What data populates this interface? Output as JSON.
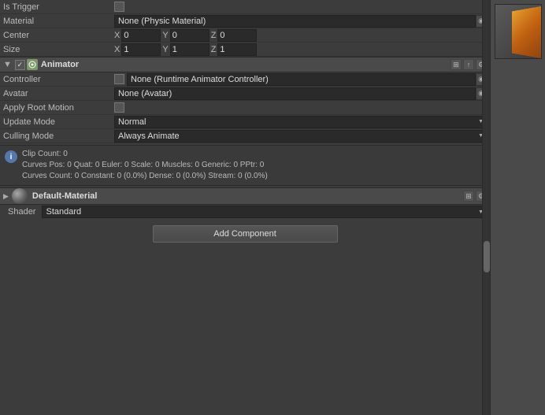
{
  "inspector": {
    "rows": {
      "is_trigger": {
        "label": "Is Trigger",
        "value": ""
      },
      "material": {
        "label": "Material",
        "value": "None (Physic Material)"
      },
      "center": {
        "label": "Center",
        "x_label": "X",
        "x_value": "0",
        "y_label": "Y",
        "y_value": "0",
        "z_label": "Z",
        "z_value": "0"
      },
      "size": {
        "label": "Size",
        "x_label": "X",
        "x_value": "1",
        "y_label": "Y",
        "y_value": "1",
        "z_label": "Z",
        "z_value": "1"
      }
    },
    "animator": {
      "title": "Animator",
      "controller": {
        "label": "Controller",
        "value": "None (Runtime Animator Controller)"
      },
      "avatar": {
        "label": "Avatar",
        "value": "None (Avatar)"
      },
      "apply_root_motion": {
        "label": "Apply Root Motion"
      },
      "update_mode": {
        "label": "Update Mode",
        "value": "Normal"
      },
      "culling_mode": {
        "label": "Culling Mode",
        "value": "Always Animate"
      },
      "info": {
        "clip_count": "Clip Count: 0",
        "curves": "Curves Pos: 0 Quat: 0 Euler: 0 Scale: 0 Muscles: 0 Generic: 0 PPtr: 0",
        "curves2": "Curves Count: 0 Constant: 0 (0.0%) Dense: 0 (0.0%) Stream: 0 (0.0%)"
      }
    },
    "material_section": {
      "title": "Default-Material",
      "shader_label": "Shader",
      "shader_value": "Standard"
    },
    "add_component": "Add Component"
  }
}
